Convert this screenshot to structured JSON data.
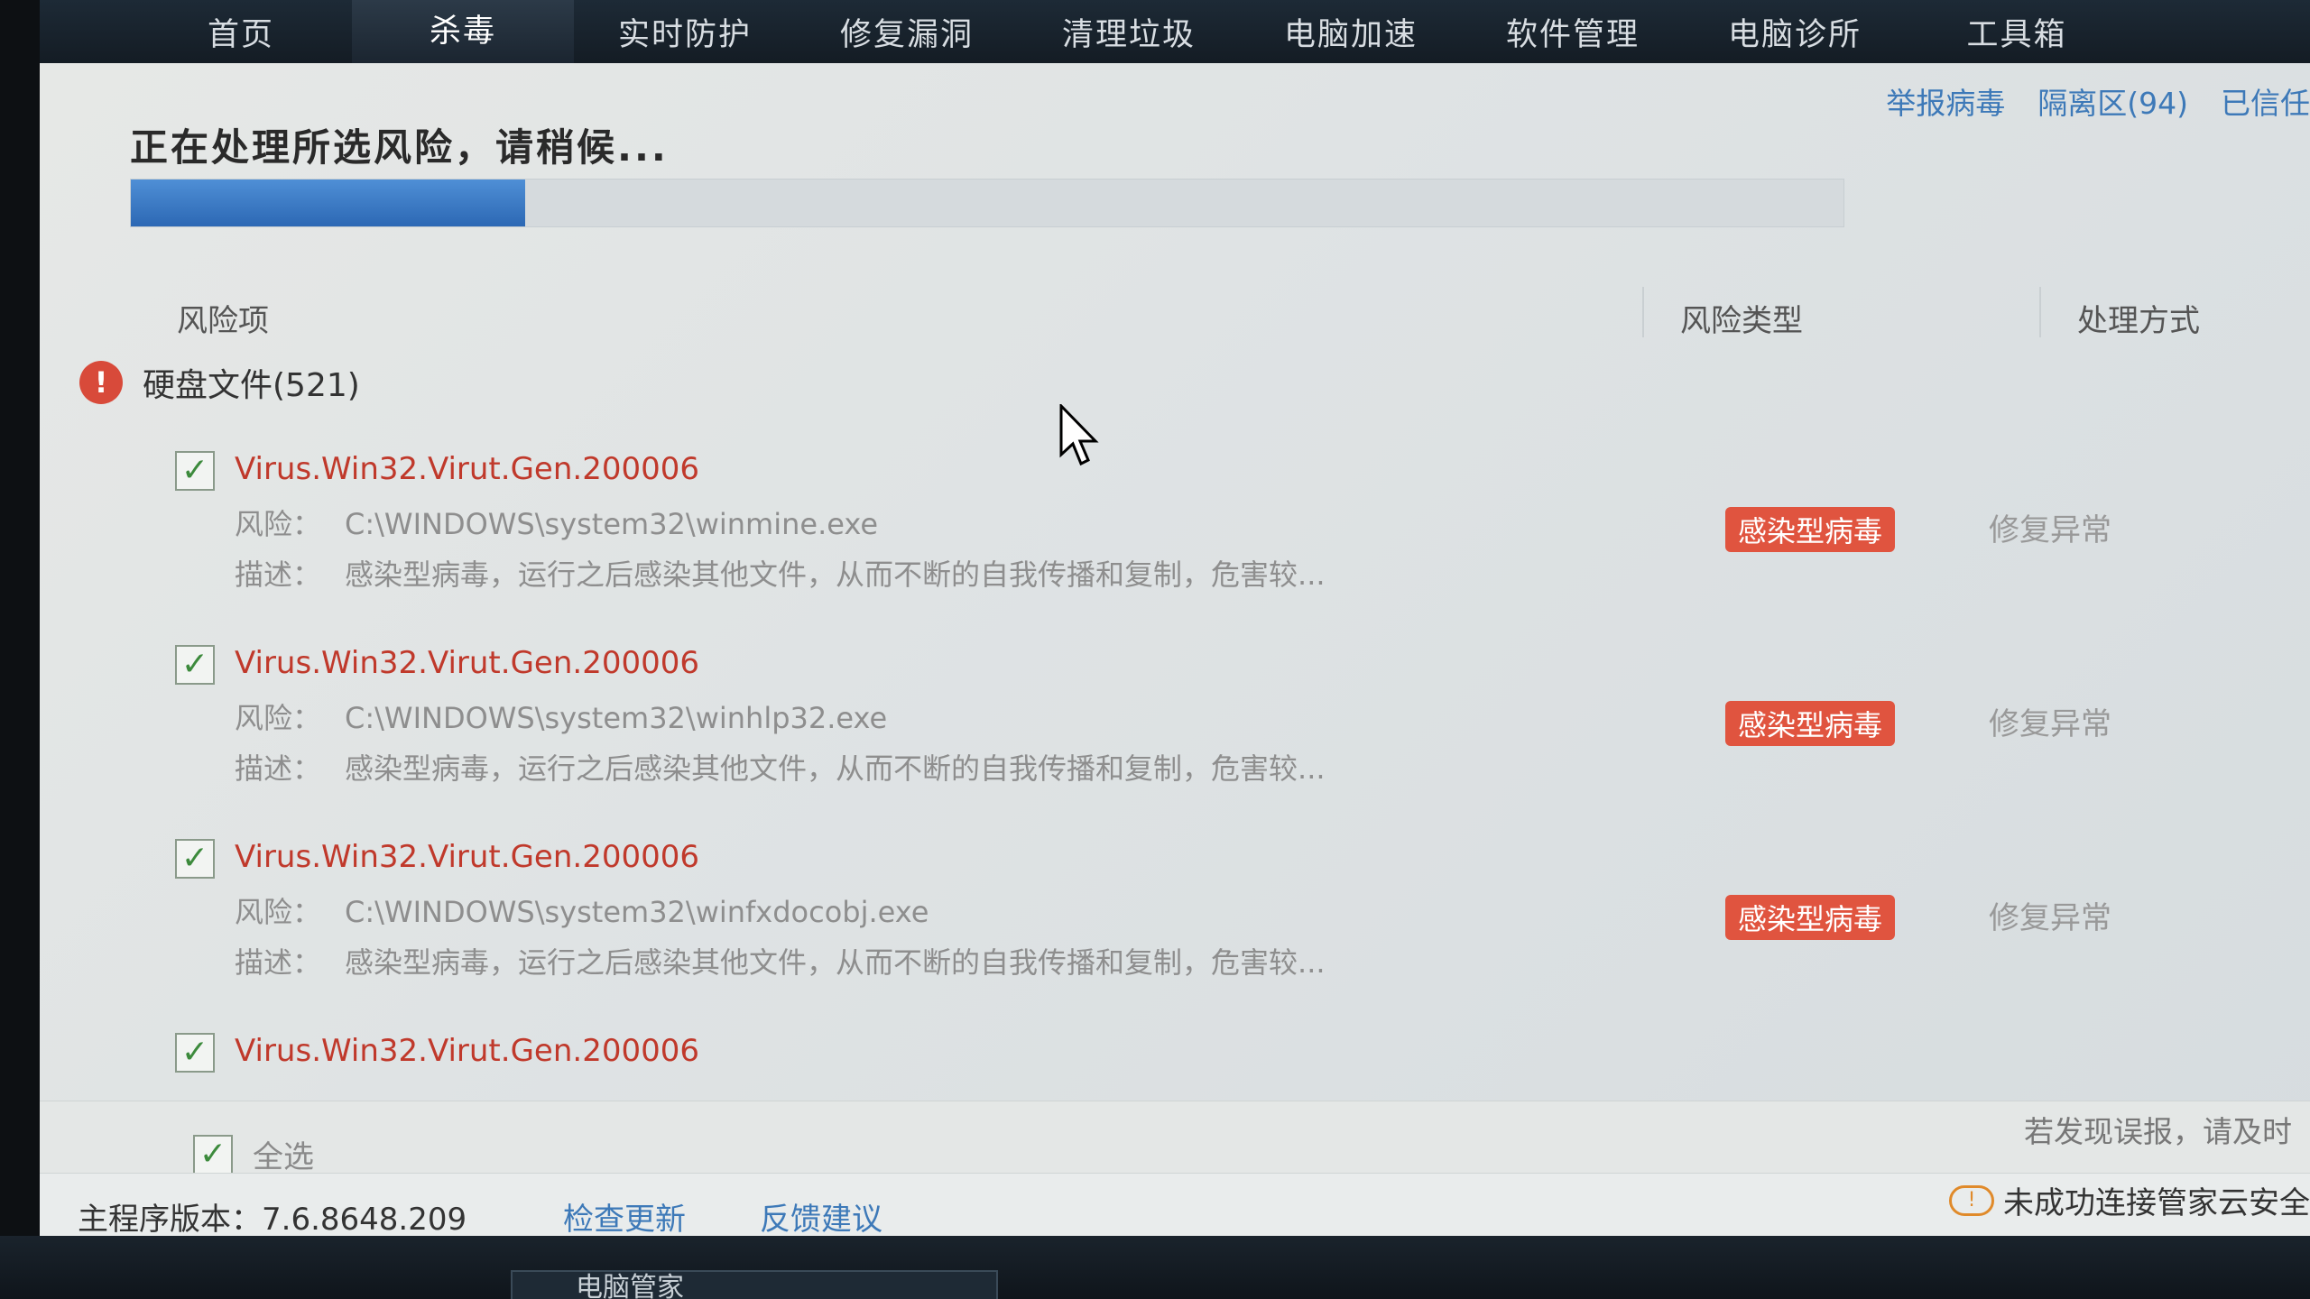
{
  "nav": {
    "items": [
      "首页",
      "杀毒",
      "实时防护",
      "修复漏洞",
      "清理垃圾",
      "电脑加速",
      "软件管理",
      "电脑诊所",
      "工具箱"
    ],
    "active_index": 1
  },
  "toplinks": [
    "举报病毒",
    "隔离区(94)",
    "已信任"
  ],
  "status": {
    "title": "正在处理所选风险，请稍候...",
    "progress": 0.23
  },
  "columns": {
    "risk_item": "风险项",
    "risk_type": "风险类型",
    "action": "处理方式"
  },
  "group": {
    "label": "硬盘文件(521)"
  },
  "items": [
    {
      "name": "Virus.Win32.Virut.Gen.200006",
      "path_label": "风险：",
      "path": "C:\\WINDOWS\\system32\\winmine.exe",
      "desc_label": "描述：",
      "desc": "感染型病毒，运行之后感染其他文件，从而不断的自我传播和复制，危害较...",
      "type": "感染型病毒",
      "action": "修复异常"
    },
    {
      "name": "Virus.Win32.Virut.Gen.200006",
      "path_label": "风险：",
      "path": "C:\\WINDOWS\\system32\\winhlp32.exe",
      "desc_label": "描述：",
      "desc": "感染型病毒，运行之后感染其他文件，从而不断的自我传播和复制，危害较...",
      "type": "感染型病毒",
      "action": "修复异常"
    },
    {
      "name": "Virus.Win32.Virut.Gen.200006",
      "path_label": "风险：",
      "path": "C:\\WINDOWS\\system32\\winfxdocobj.exe",
      "desc_label": "描述：",
      "desc": "感染型病毒，运行之后感染其他文件，从而不断的自我传播和复制，危害较...",
      "type": "感染型病毒",
      "action": "修复异常"
    },
    {
      "name": "Virus.Win32.Virut.Gen.200006"
    }
  ],
  "select_all": "全选",
  "misreport": "若发现误报，请及时",
  "footer": {
    "version": "主程序版本：7.6.8648.209",
    "check_update": "检查更新",
    "feedback": "反馈建议",
    "cloud_status": "未成功连接管家云安全"
  },
  "taskbar": {
    "task_label": "电脑管家"
  },
  "colors": {
    "accent": "#3d79b8",
    "danger": "#e0543f",
    "progress": "#2c68b4"
  }
}
